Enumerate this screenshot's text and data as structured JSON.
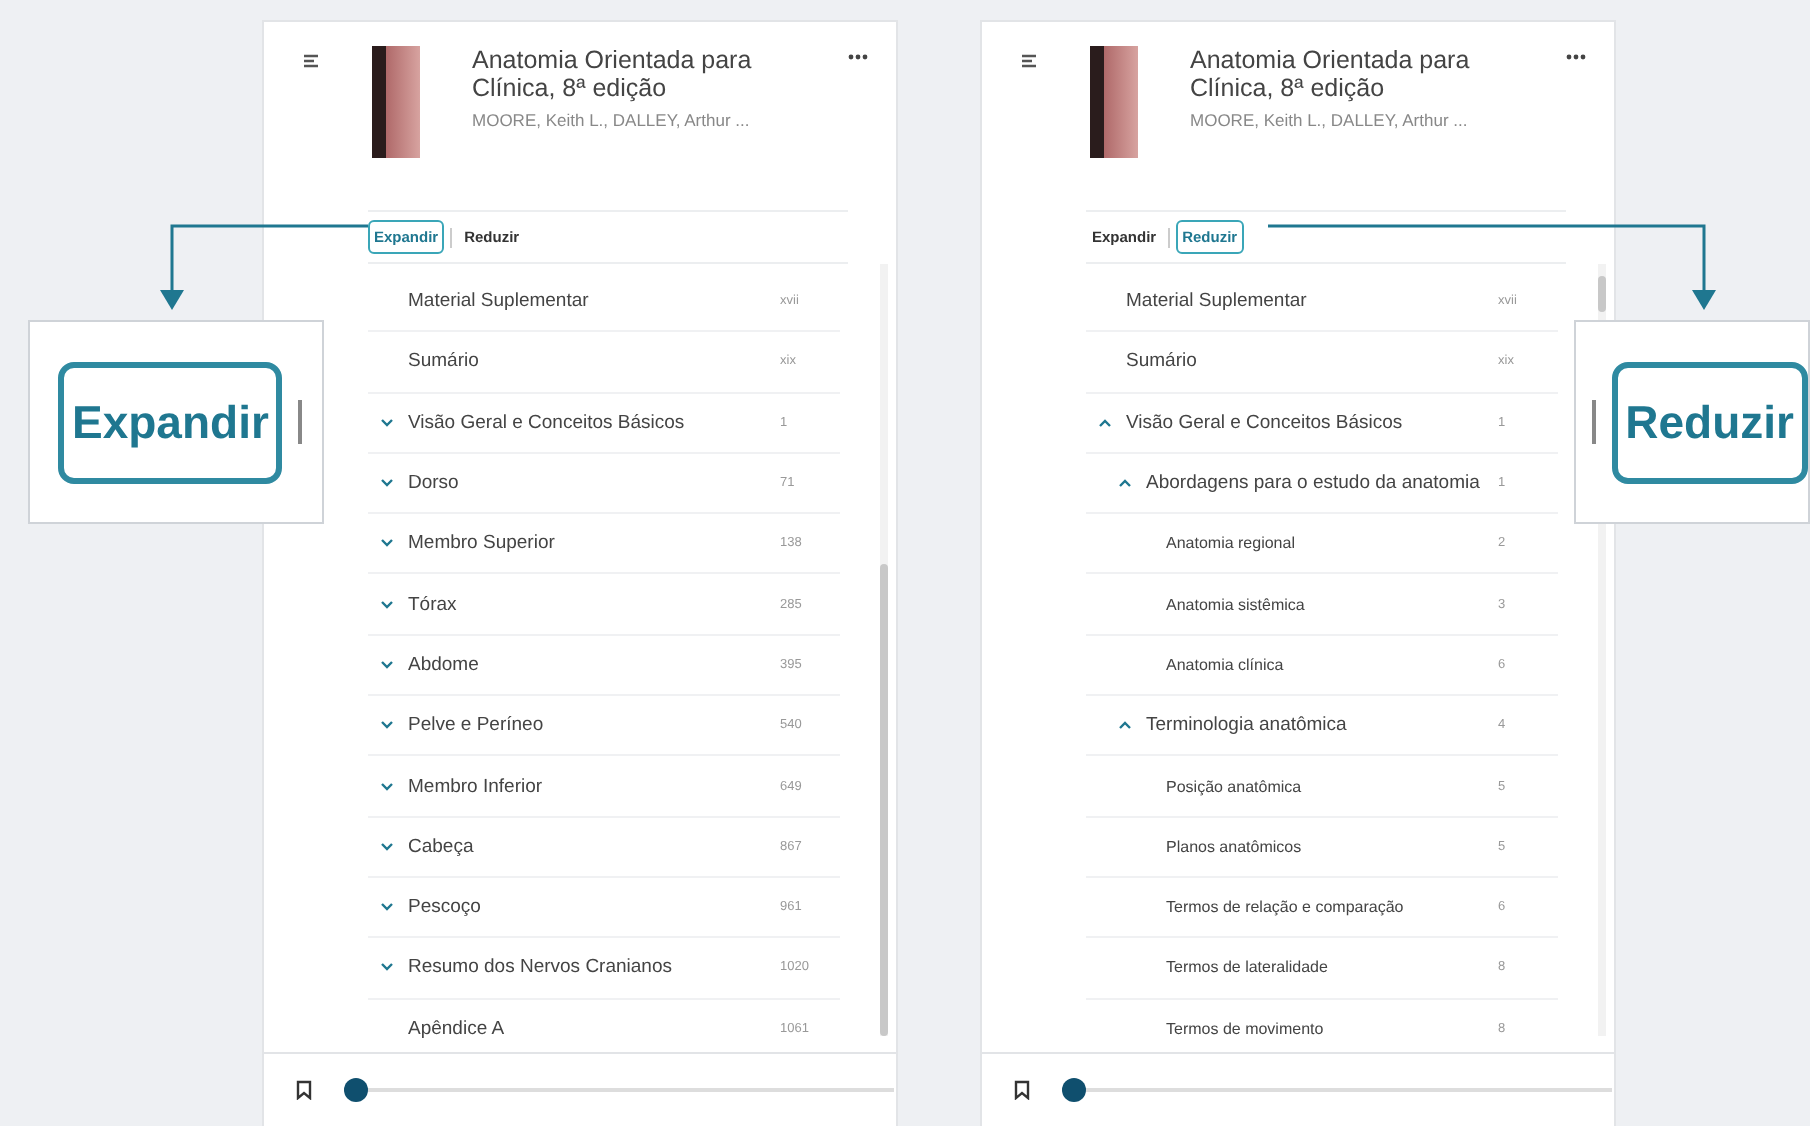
{
  "panels": [
    {
      "header": {
        "title": "Anatomia Orientada para Clínica, 8ª edição",
        "authors": "MOORE, Keith L., DALLEY, Arthur ..."
      },
      "toggle": [
        {
          "label": "Expandir",
          "selected": true
        },
        {
          "label": "Reduzir",
          "selected": false
        }
      ],
      "items": [
        {
          "label": "Material Suplementar",
          "page": "xvii",
          "kind": "plain"
        },
        {
          "label": "Sumário",
          "page": "xix",
          "kind": "plain"
        },
        {
          "label": "Visão Geral e Conceitos Básicos",
          "page": "1",
          "kind": "chapter",
          "expanded": false
        },
        {
          "label": "Dorso",
          "page": "71",
          "kind": "chapter",
          "expanded": false
        },
        {
          "label": "Membro Superior",
          "page": "138",
          "kind": "chapter",
          "expanded": false
        },
        {
          "label": "Tórax",
          "page": "285",
          "kind": "chapter",
          "expanded": false
        },
        {
          "label": "Abdome",
          "page": "395",
          "kind": "chapter",
          "expanded": false
        },
        {
          "label": "Pelve e Períneo",
          "page": "540",
          "kind": "chapter",
          "expanded": false
        },
        {
          "label": "Membro Inferior",
          "page": "649",
          "kind": "chapter",
          "expanded": false
        },
        {
          "label": "Cabeça",
          "page": "867",
          "kind": "chapter",
          "expanded": false
        },
        {
          "label": "Pescoço",
          "page": "961",
          "kind": "chapter",
          "expanded": false
        },
        {
          "label": "Resumo dos Nervos Cranianos",
          "page": "1020",
          "kind": "chapter",
          "expanded": false
        },
        {
          "label": "Apêndice A",
          "page": "1061",
          "kind": "plain"
        }
      ],
      "progress": {
        "level": 0.0
      }
    },
    {
      "header": {
        "title": "Anatomia Orientada para Clínica, 8ª edição",
        "authors": "MOORE, Keith L., DALLEY, Arthur ..."
      },
      "toggle": [
        {
          "label": "Expandir",
          "selected": false
        },
        {
          "label": "Reduzir",
          "selected": true
        }
      ],
      "items": [
        {
          "label": "Material Suplementar",
          "page": "xvii",
          "kind": "plain"
        },
        {
          "label": "Sumário",
          "page": "xix",
          "kind": "plain"
        },
        {
          "label": "Visão Geral e Conceitos Básicos",
          "page": "1",
          "kind": "chapter",
          "expanded": true,
          "children": [
            {
              "label": "Abordagens para o estudo da anatomia",
              "page": "1",
              "kind": "chapter",
              "expanded": true,
              "children": [
                {
                  "label": "Anatomia regional",
                  "page": "2",
                  "kind": "plain"
                },
                {
                  "label": "Anatomia sistêmica",
                  "page": "3",
                  "kind": "plain"
                },
                {
                  "label": "Anatomia clínica",
                  "page": "6",
                  "kind": "plain"
                }
              ]
            },
            {
              "label": "Terminologia anatômica",
              "page": "4",
              "kind": "chapter",
              "expanded": true,
              "children": [
                {
                  "label": "Posição anatômica",
                  "page": "5",
                  "kind": "plain"
                },
                {
                  "label": "Planos anatômicos",
                  "page": "5",
                  "kind": "plain"
                },
                {
                  "label": "Termos de relação e comparação",
                  "page": "6",
                  "kind": "plain"
                },
                {
                  "label": "Termos de lateralidade",
                  "page": "8",
                  "kind": "plain"
                },
                {
                  "label": "Termos de movimento",
                  "page": "8",
                  "kind": "plain"
                }
              ]
            }
          ]
        }
      ],
      "progress": {
        "level": 0.0
      }
    }
  ],
  "callouts": [
    {
      "label": "Expandir"
    },
    {
      "label": "Reduzir"
    }
  ]
}
